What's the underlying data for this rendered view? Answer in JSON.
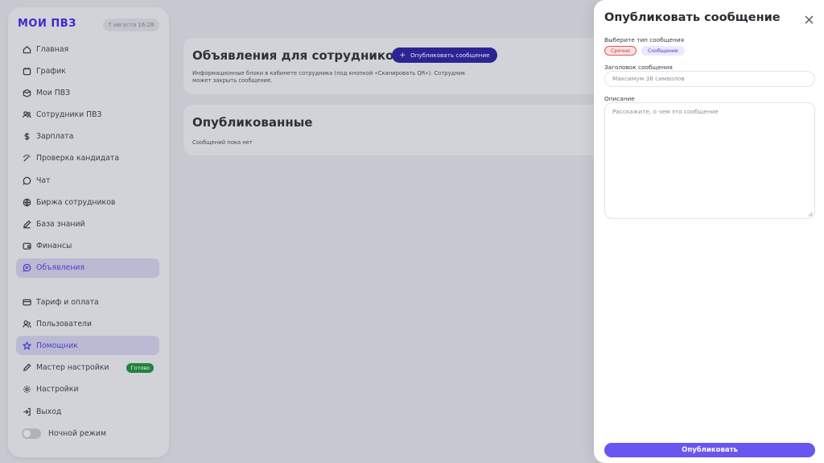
{
  "sidebar": {
    "logo": "МОИ ПВЗ",
    "date": "7 августа 16:28",
    "items": [
      {
        "label": "Главная",
        "icon": "home-icon"
      },
      {
        "label": "График",
        "icon": "calendar-icon"
      },
      {
        "label": "Мои ПВЗ",
        "icon": "box-icon"
      },
      {
        "label": "Сотрудники ПВЗ",
        "icon": "users-icon"
      },
      {
        "label": "Зарплата",
        "icon": "dollar-icon"
      },
      {
        "label": "Проверка кандидата",
        "icon": "wand-icon"
      },
      {
        "label": "Чат",
        "icon": "chat-icon"
      },
      {
        "label": "Биржа сотрудников",
        "icon": "globe-icon"
      },
      {
        "label": "База знаний",
        "icon": "pen-icon"
      },
      {
        "label": "Финансы",
        "icon": "wallet-icon"
      },
      {
        "label": "Объявления",
        "icon": "message-icon"
      }
    ],
    "items2": [
      {
        "label": "Тариф и оплата",
        "icon": "card-icon"
      },
      {
        "label": "Пользователи",
        "icon": "user-icon"
      },
      {
        "label": "Помощник",
        "icon": "star-icon"
      },
      {
        "label": "Мастер настройки",
        "icon": "pen-icon",
        "badge": "Готово"
      },
      {
        "label": "Настройки",
        "icon": "gear-icon"
      },
      {
        "label": "Выход",
        "icon": "logout-icon"
      }
    ],
    "night_mode": "Ночной режим"
  },
  "main": {
    "announcements_title": "Объявления для сотрудников",
    "publish_button": "Опубликовать сообщение",
    "announcements_desc": "Информационные блоки в кабинете сотрудника (под кнопкой «Сканировать QR»). Сотрудник может закрыть сообщение.",
    "published_title": "Опубликованные",
    "published_empty": "Сообщений пока нет"
  },
  "drawer": {
    "title": "Опубликовать сообщение",
    "type_label": "Выберите тип сообщения",
    "type_urgent": "Срочно",
    "type_message": "Сообщение",
    "header_label": "Заголовок сообщения",
    "header_placeholder": "Максимум 38 символов",
    "desc_label": "Описание",
    "desc_placeholder": "Расскажите, о чем это сообщение",
    "submit": "Опубликовать"
  },
  "colors": {
    "accent": "#6955f0",
    "brand": "#3a2ad0",
    "ready_badge": "#23823f"
  }
}
